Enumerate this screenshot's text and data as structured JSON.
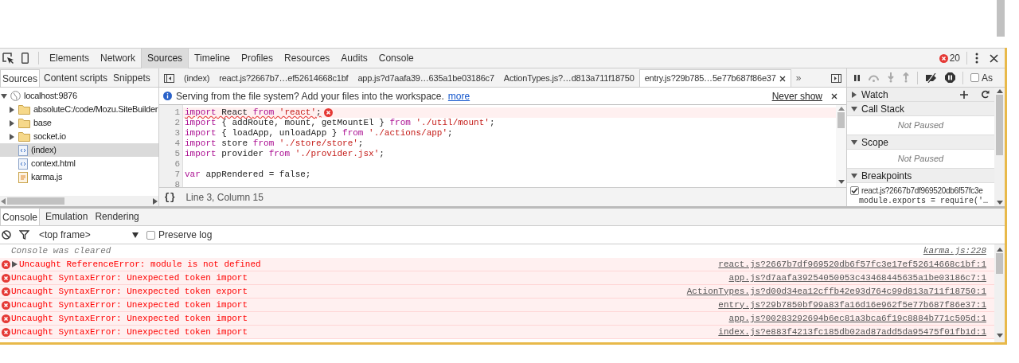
{
  "main_tabs": [
    {
      "label": "Elements",
      "selected": false
    },
    {
      "label": "Network",
      "selected": false
    },
    {
      "label": "Sources",
      "selected": true
    },
    {
      "label": "Timeline",
      "selected": false
    },
    {
      "label": "Profiles",
      "selected": false
    },
    {
      "label": "Resources",
      "selected": false
    },
    {
      "label": "Audits",
      "selected": false
    },
    {
      "label": "Console",
      "selected": false
    }
  ],
  "error_count": "20",
  "navigator": {
    "tabs": [
      {
        "label": "Sources",
        "selected": true
      },
      {
        "label": "Content scripts",
        "selected": false
      },
      {
        "label": "Snippets",
        "selected": false
      }
    ],
    "tree": [
      {
        "label": "localhost:9876",
        "kind": "origin",
        "expanded": true,
        "selected": false,
        "children": [
          {
            "label": "absoluteC:/code/Mozu.SiteBuilder",
            "kind": "folder",
            "expanded": false,
            "selected": false
          },
          {
            "label": "base",
            "kind": "folder",
            "expanded": false,
            "selected": false
          },
          {
            "label": "socket.io",
            "kind": "folder",
            "expanded": false,
            "selected": false
          },
          {
            "label": "(index)",
            "kind": "html",
            "selected": true
          },
          {
            "label": "context.html",
            "kind": "html",
            "selected": false
          },
          {
            "label": "karma.js",
            "kind": "script",
            "selected": false
          }
        ]
      }
    ]
  },
  "editor": {
    "tabs": [
      {
        "label": "(index)",
        "selected": false,
        "closable": false
      },
      {
        "label": "react.js?2667b7…ef52614668c1bf",
        "selected": false,
        "closable": false
      },
      {
        "label": "app.js?d7aafa39…635a1be03186c7",
        "selected": false,
        "closable": false
      },
      {
        "label": "ActionTypes.js?…d813a711f18750",
        "selected": false,
        "closable": false
      },
      {
        "label": "entry.js?29b785…5e77b687f86e37",
        "selected": true,
        "closable": true
      }
    ],
    "overflow": "»",
    "infobar": {
      "message": "Serving from the file system? Add your files into the workspace.",
      "link": "more",
      "dismiss": "Never show"
    },
    "lines": [
      {
        "number": "1",
        "error": true,
        "tokens": [
          {
            "text": "import",
            "kind": "keyword"
          },
          {
            "text": " React ",
            "kind": "plain"
          },
          {
            "text": "from",
            "kind": "keyword"
          },
          {
            "text": " 'react'",
            "kind": "string"
          },
          {
            "text": ";",
            "kind": "plain"
          }
        ]
      },
      {
        "number": "2",
        "error": false,
        "tokens": [
          {
            "text": "import",
            "kind": "keyword"
          },
          {
            "text": " { addRoute, mount, getMountEl } ",
            "kind": "plain"
          },
          {
            "text": "from",
            "kind": "keyword"
          },
          {
            "text": " './util/mount'",
            "kind": "string"
          },
          {
            "text": ";",
            "kind": "plain"
          }
        ]
      },
      {
        "number": "3",
        "error": false,
        "tokens": [
          {
            "text": "import",
            "kind": "keyword"
          },
          {
            "text": " { loadApp, unloadApp } ",
            "kind": "plain"
          },
          {
            "text": "from",
            "kind": "keyword"
          },
          {
            "text": " './actions/app'",
            "kind": "string"
          },
          {
            "text": ";",
            "kind": "plain"
          }
        ]
      },
      {
        "number": "4",
        "error": false,
        "tokens": [
          {
            "text": "import",
            "kind": "keyword"
          },
          {
            "text": " store ",
            "kind": "plain"
          },
          {
            "text": "from",
            "kind": "keyword"
          },
          {
            "text": " './store/store'",
            "kind": "string"
          },
          {
            "text": ";",
            "kind": "plain"
          }
        ]
      },
      {
        "number": "5",
        "error": false,
        "tokens": [
          {
            "text": "import",
            "kind": "keyword"
          },
          {
            "text": " provider ",
            "kind": "plain"
          },
          {
            "text": "from",
            "kind": "keyword"
          },
          {
            "text": " './provider.jsx'",
            "kind": "string"
          },
          {
            "text": ";",
            "kind": "plain"
          }
        ]
      },
      {
        "number": "6",
        "error": false
      },
      {
        "number": "7",
        "error": false,
        "tokens": [
          {
            "text": "var",
            "kind": "keyword"
          },
          {
            "text": " appRendered = false;",
            "kind": "plain"
          }
        ]
      },
      {
        "number": "8",
        "error": false
      }
    ],
    "pretty_print": "{}",
    "cursor": "Line 3, Column 15"
  },
  "debugger": {
    "pause_option": {
      "label": "As",
      "checked": false
    },
    "sections": [
      {
        "title": "Watch",
        "expanded": false
      },
      {
        "title": "Call Stack",
        "expanded": true,
        "empty_text": "Not Paused"
      },
      {
        "title": "Scope",
        "expanded": true,
        "empty_text": "Not Paused"
      },
      {
        "title": "Breakpoints",
        "expanded": true,
        "breakpoints": [
          {
            "file": "react.js?2667b7df969520db6f57fc3e",
            "code": "module.exports = require('…",
            "checked": true
          }
        ]
      }
    ]
  },
  "drawer": {
    "tabs": [
      {
        "label": "Console",
        "selected": true
      },
      {
        "label": "Emulation",
        "selected": false
      },
      {
        "label": "Rendering",
        "selected": false
      }
    ],
    "context": "<top frame>",
    "preserve_log": {
      "label": "Preserve log",
      "checked": false
    },
    "messages": [
      {
        "kind": "info",
        "text": "Console was cleared",
        "source": "karma.js:228"
      },
      {
        "kind": "error",
        "expandable": true,
        "text": "Uncaught ReferenceError: module is not defined",
        "source": "react.js?2667b7df969520db6f57fc3e17ef52614668c1bf:1"
      },
      {
        "kind": "error",
        "text": "Uncaught SyntaxError: Unexpected token import",
        "source": "app.js?d7aafa39254050053c43468445635a1be03186c7:1"
      },
      {
        "kind": "error",
        "text": "Uncaught SyntaxError: Unexpected token export",
        "source": "ActionTypes.js?d00d34ea12cffb42e93d764c99d813a711f18750:1"
      },
      {
        "kind": "error",
        "text": "Uncaught SyntaxError: Unexpected token import",
        "source": "entry.js?29b7850bf99a83fa16d16e962f5e77b687f86e37:1"
      },
      {
        "kind": "error",
        "text": "Uncaught SyntaxError: Unexpected token import",
        "source": "app.js?00283292694b6ec81a3bca6f19c8884b771c505d:1"
      },
      {
        "kind": "error",
        "text": "Uncaught SyntaxError: Unexpected token import",
        "source": "index.js?e883f4213fc185db02ad87add5da95475f01fb1d:1"
      }
    ]
  }
}
